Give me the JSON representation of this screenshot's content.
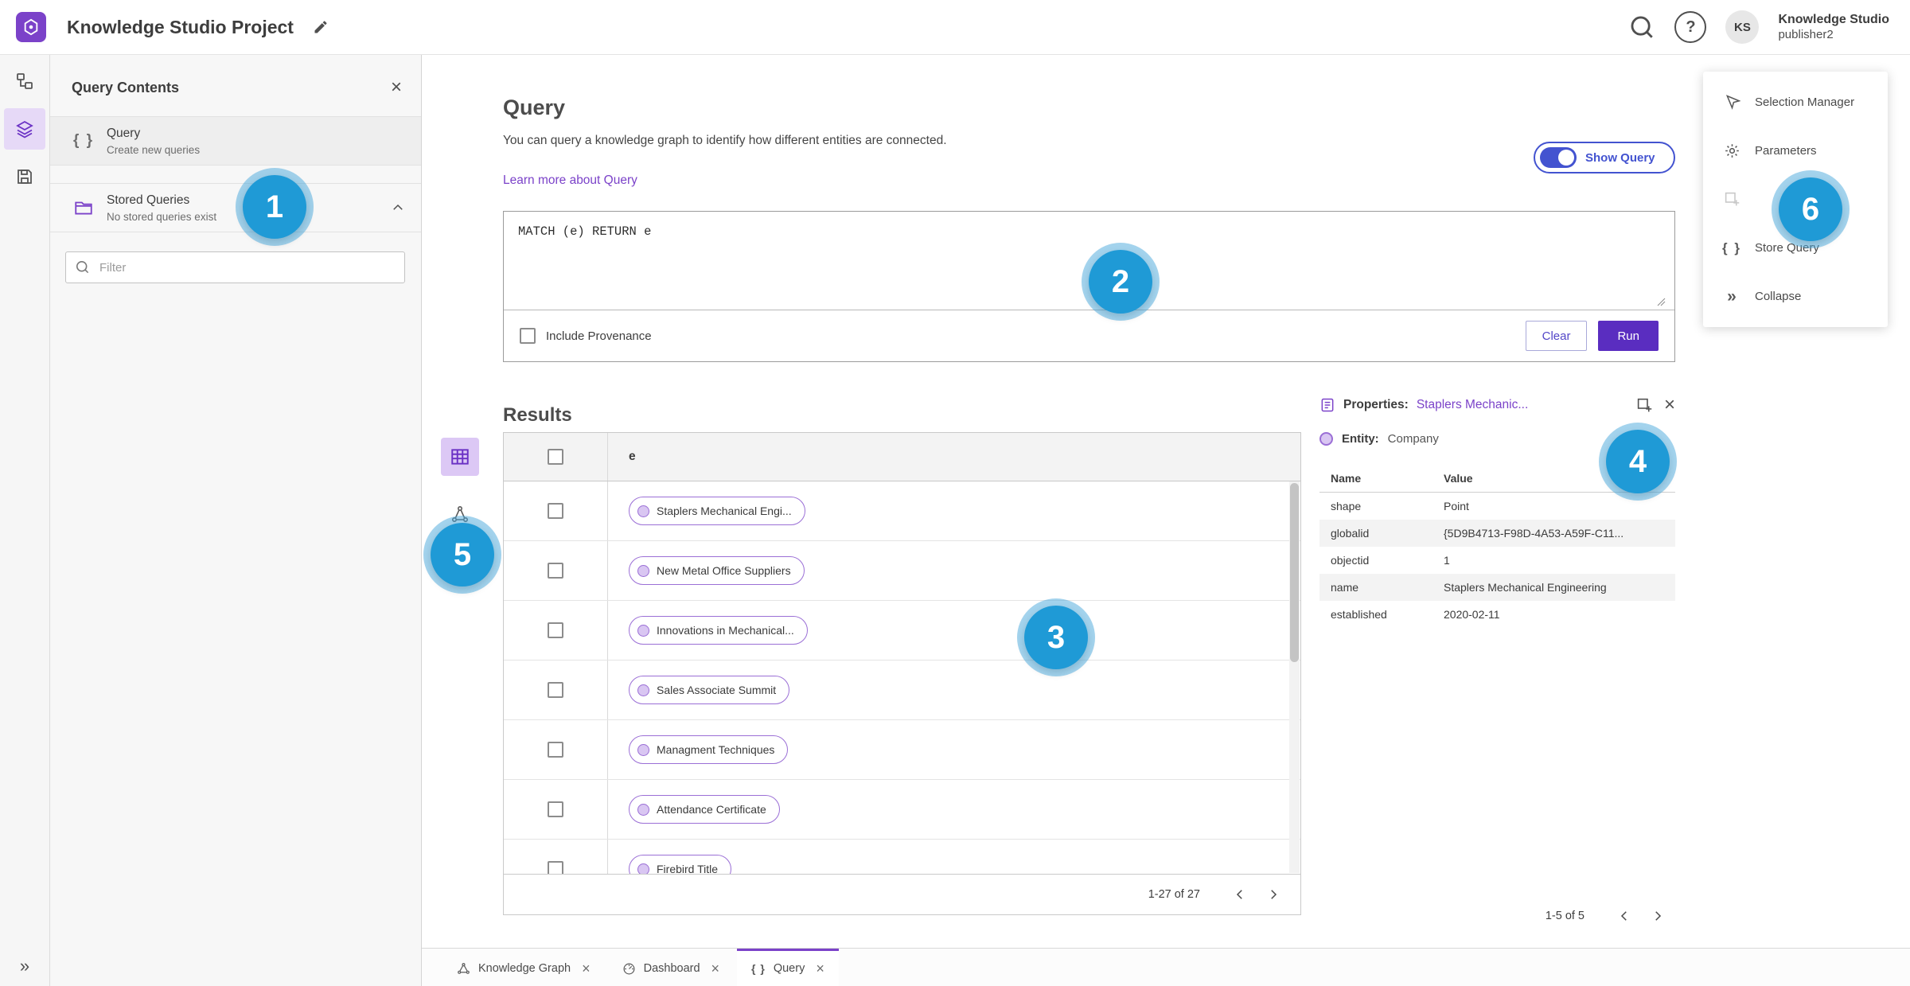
{
  "colors": {
    "accent_purple": "#7b42c9",
    "run_button_purple": "#5a2dc0",
    "toggle_indigo": "#4353d0",
    "annotation_badge_blue": "#1f9ad6"
  },
  "header": {
    "app_title": "Knowledge Studio Project",
    "user": {
      "initials": "KS",
      "name": "Knowledge Studio",
      "username": "publisher2"
    }
  },
  "left_panel": {
    "title": "Query Contents",
    "items": [
      {
        "label": "Query",
        "sublabel": "Create new queries"
      },
      {
        "label": "Stored Queries",
        "sublabel": "No stored queries exist"
      }
    ],
    "filter_placeholder": "Filter"
  },
  "query": {
    "title": "Query",
    "description": "You can query a knowledge graph to identify how different entities are connected.",
    "learn_more": "Learn more about Query",
    "show_query_label": "Show Query",
    "editor_text": "MATCH (e) RETURN e",
    "include_provenance_label": "Include Provenance",
    "clear_label": "Clear",
    "run_label": "Run"
  },
  "results": {
    "title": "Results",
    "column_header": "e",
    "rows": [
      "Staplers Mechanical Engi...",
      "New Metal Office Suppliers",
      "Innovations in Mechanical...",
      "Sales Associate Summit",
      "Managment Techniques",
      "Attendance Certificate",
      "Firebird Title"
    ],
    "pagination": "1-27 of 27"
  },
  "properties": {
    "label": "Properties:",
    "link": "Staplers Mechanic...",
    "entity_label": "Entity:",
    "entity_value": "Company",
    "columns": [
      "Name",
      "Value"
    ],
    "rows": [
      {
        "name": "shape",
        "value": "Point"
      },
      {
        "name": "globalid",
        "value": "{5D9B4713-F98D-4A53-A59F-C11..."
      },
      {
        "name": "objectid",
        "value": "1"
      },
      {
        "name": "name",
        "value": "Staplers Mechanical Engineering"
      },
      {
        "name": "established",
        "value": "2020-02-11"
      }
    ],
    "pagination": "1-5 of 5"
  },
  "menu": {
    "items": [
      {
        "label": "Selection Manager"
      },
      {
        "label": "Parameters"
      },
      {
        "label": ""
      },
      {
        "label": "Store Query"
      },
      {
        "label": "Collapse"
      }
    ]
  },
  "tabs": [
    {
      "label": "Knowledge Graph"
    },
    {
      "label": "Dashboard"
    },
    {
      "label": "Query"
    }
  ],
  "badges": [
    "1",
    "2",
    "3",
    "4",
    "5",
    "6"
  ]
}
